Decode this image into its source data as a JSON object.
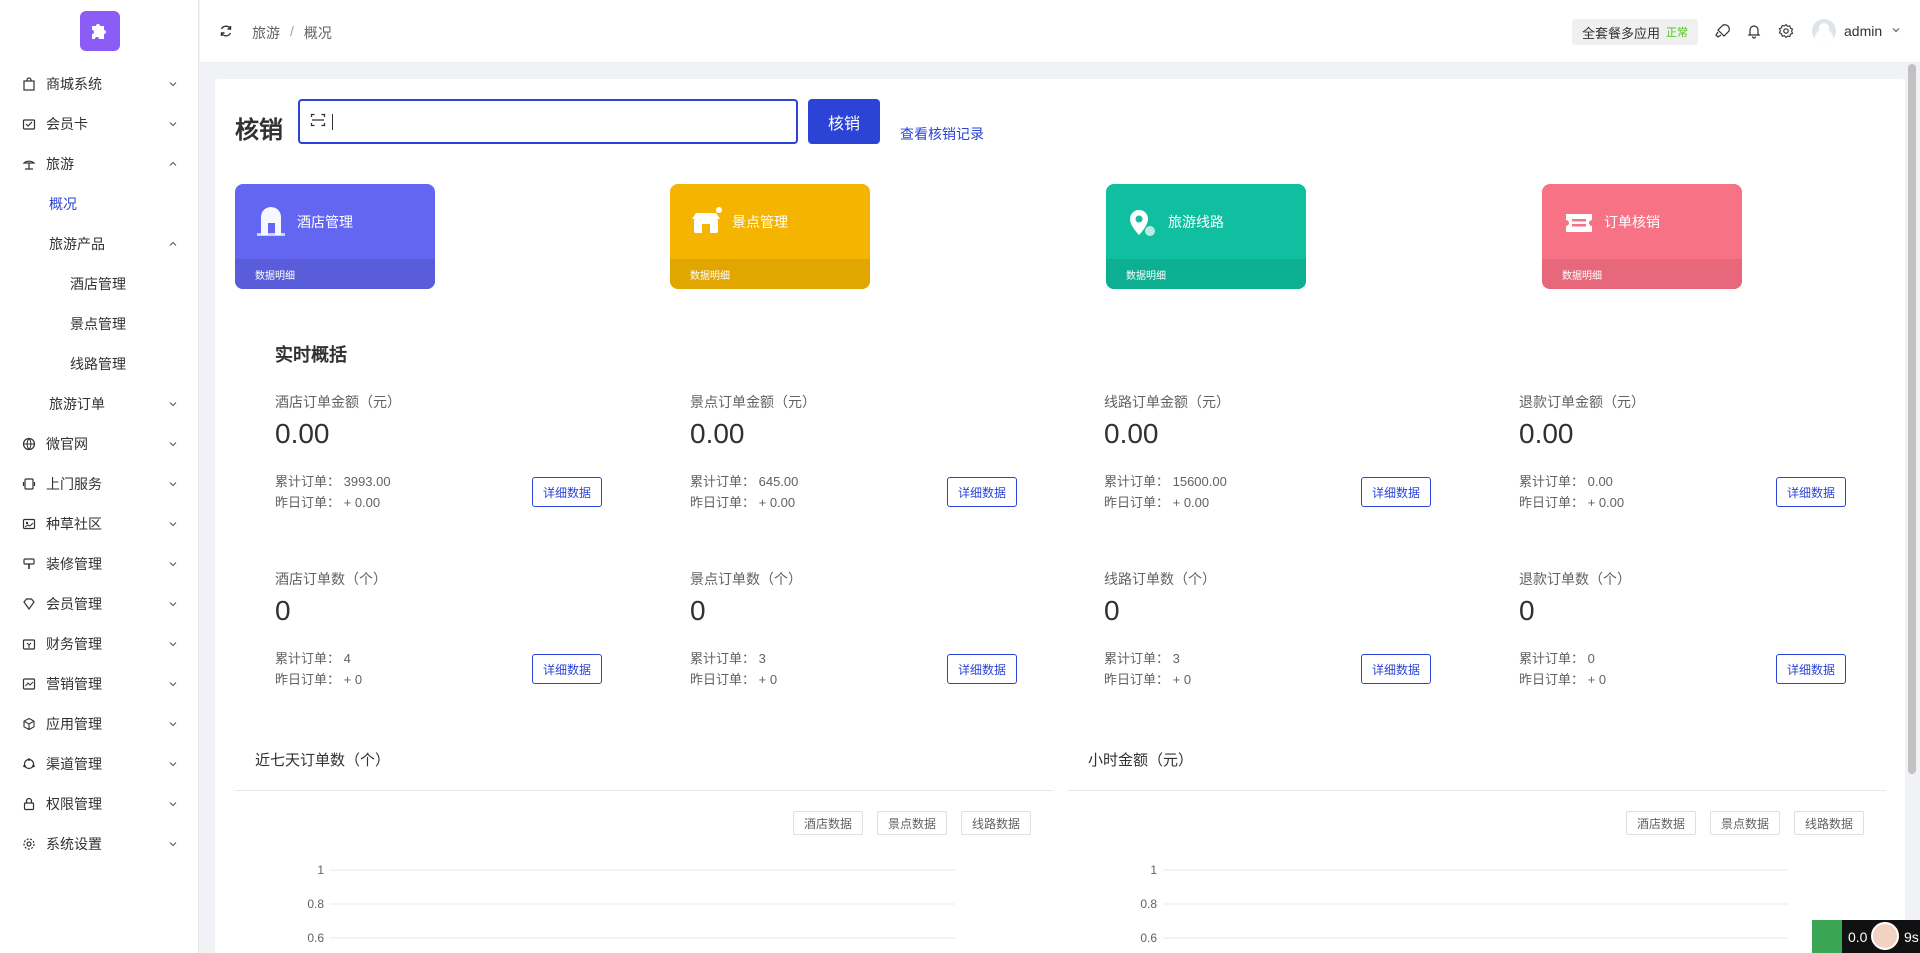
{
  "sidebar": {
    "items": [
      {
        "label": "商城系统"
      },
      {
        "label": "会员卡"
      },
      {
        "label": "旅游"
      },
      {
        "label": "概况"
      },
      {
        "label": "旅游产品"
      },
      {
        "label": "酒店管理"
      },
      {
        "label": "景点管理"
      },
      {
        "label": "线路管理"
      },
      {
        "label": "旅游订单"
      },
      {
        "label": "微官网"
      },
      {
        "label": "上门服务"
      },
      {
        "label": "种草社区"
      },
      {
        "label": "装修管理"
      },
      {
        "label": "会员管理"
      },
      {
        "label": "财务管理"
      },
      {
        "label": "营销管理"
      },
      {
        "label": "应用管理"
      },
      {
        "label": "渠道管理"
      },
      {
        "label": "权限管理"
      },
      {
        "label": "系统设置"
      }
    ]
  },
  "header": {
    "breadcrumb": [
      "旅游",
      "概况"
    ],
    "breadcrumb_sep": "/",
    "package_label": "全套餐多应用",
    "package_status": "正常",
    "username": "admin"
  },
  "verify": {
    "title": "核销",
    "placeholder": "",
    "button": "核销",
    "link": "查看核销记录"
  },
  "quick_cards": [
    {
      "name": "酒店管理",
      "sub": "数据明细",
      "color": "#6366f1",
      "icon": "hotel-icon"
    },
    {
      "name": "景点管理",
      "sub": "数据明细",
      "color": "#f5b400",
      "icon": "scenic-spot-icon"
    },
    {
      "name": "旅游线路",
      "sub": "数据明细",
      "color": "#0fbf9f",
      "icon": "route-location-icon"
    },
    {
      "name": "订单核销",
      "sub": "数据明细",
      "color": "#f87286",
      "icon": "ticket-icon"
    }
  ],
  "overview": {
    "title": "实时概括",
    "detail_button": "详细数据",
    "stats": [
      {
        "label": "酒店订单金额（元）",
        "value": "0.00",
        "total": "累计订单：  3993.00",
        "yesterday": "昨日订单：  + 0.00"
      },
      {
        "label": "景点订单金额（元）",
        "value": "0.00",
        "total": "累计订单：  645.00",
        "yesterday": "昨日订单：  + 0.00"
      },
      {
        "label": "线路订单金额（元）",
        "value": "0.00",
        "total": "累计订单：  15600.00",
        "yesterday": "昨日订单：  + 0.00"
      },
      {
        "label": "退款订单金额（元）",
        "value": "0.00",
        "total": "累计订单：  0.00",
        "yesterday": "昨日订单：  + 0.00"
      },
      {
        "label": "酒店订单数（个）",
        "value": "0",
        "total": "累计订单：  4",
        "yesterday": "昨日订单：  + 0"
      },
      {
        "label": "景点订单数（个）",
        "value": "0",
        "total": "累计订单：  3",
        "yesterday": "昨日订单：  + 0"
      },
      {
        "label": "线路订单数（个）",
        "value": "0",
        "total": "累计订单：  3",
        "yesterday": "昨日订单：  + 0"
      },
      {
        "label": "退款订单数（个）",
        "value": "0",
        "total": "累计订单：  0",
        "yesterday": "昨日订单：  + 0"
      }
    ]
  },
  "chart_data": [
    {
      "type": "line",
      "title": "近七天订单数（个）",
      "tabs": [
        "酒店数据",
        "景点数据",
        "线路数据"
      ],
      "yticks": [
        "1",
        "0.8",
        "0.6"
      ],
      "ylim": [
        0,
        1
      ],
      "series": []
    },
    {
      "type": "line",
      "title": "小时金额（元）",
      "tabs": [
        "酒店数据",
        "景点数据",
        "线路数据"
      ],
      "yticks": [
        "1",
        "0.8",
        "0.6"
      ],
      "ylim": [
        0,
        1
      ],
      "series": []
    }
  ],
  "corner_widget": {
    "text": "0.0",
    "text2": "9s"
  },
  "colors": {
    "primary": "#2b44d6",
    "status_ok": "#52c41a"
  }
}
